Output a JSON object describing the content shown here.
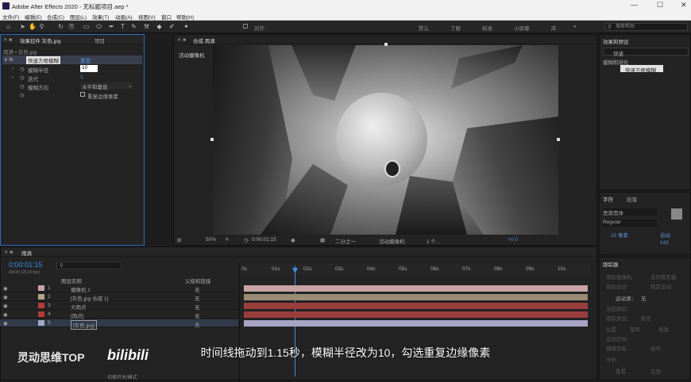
{
  "window": {
    "title": "Adobe After Effects 2020 - 无标题项目.aep *",
    "min": "—",
    "max": "☐",
    "close": "✕"
  },
  "menu": [
    "文件(F)",
    "编辑(E)",
    "合成(C)",
    "图层(L)",
    "效果(T)",
    "动画(A)",
    "视图(V)",
    "窗口",
    "帮助(H)"
  ],
  "toolbar": {
    "snap_label": "对齐",
    "workspaces": [
      "默认",
      "了解",
      "标准",
      "小屏幕",
      "库"
    ],
    "search_placeholder": "搜索帮助"
  },
  "effects_panel": {
    "tab_label": "效果控件 灰色.jpg",
    "project_tab": "项目",
    "breadcrumb": "雨滴 • 灰色.jpg",
    "effect_name": "快速方框模糊",
    "reset": "重置",
    "props": [
      {
        "label": "模糊半径",
        "value": "10"
      },
      {
        "label": "迭代",
        "value": "1"
      },
      {
        "label": "模糊方向",
        "value": "水平和垂直"
      }
    ],
    "checkbox_label": "重复边缘像素"
  },
  "comp_panel": {
    "tab_label": "合成 雨滴",
    "camera_label": "活动摄像机",
    "zoom": "50%",
    "timecode": "0:00:01:15",
    "resolution": "二分之一",
    "view": "活动摄像机",
    "views": "1 个...",
    "offset": "+0.0"
  },
  "right_panel": {
    "tab_label": "效果和预设",
    "search_value": "快速",
    "category": "模糊和锐化",
    "result": "快速方框模糊"
  },
  "char_panel": {
    "tab_label": "字符",
    "tab2": "段落",
    "font": "思源黑体",
    "style": "Regular",
    "size": "25 像素",
    "auto": "自动",
    "tracking": "142"
  },
  "tracker_panel": {
    "tab_label": "跟踪器",
    "track_camera": "跟踪摄像机",
    "warp": "变形稳定器",
    "track_motion": "跟踪运动",
    "stabilize": "稳定运动",
    "source_label": "运动源：",
    "source_value": "无",
    "current": "当前跟踪：",
    "type": "跟踪类型：",
    "type_value": "稳定",
    "pos": "位置",
    "rot": "旋转",
    "scale": "缩放",
    "target": "运动目标：",
    "edit_target": "编辑目标...",
    "options": "选项...",
    "analyze": "分析：",
    "reset": "重置",
    "apply": "应用"
  },
  "timeline": {
    "tab_label": "雨滴",
    "timecode": "0:00:01:15",
    "frames": "00040 (25.00 fps)",
    "col_layer": "图层名称",
    "col_parent": "父级和链接",
    "toggle": "切换开关/模式",
    "ruler": [
      "0s",
      "01s",
      "02s",
      "03s",
      "04s",
      "05s",
      "06s",
      "07s",
      "08s",
      "09s",
      "10s"
    ],
    "layers": [
      {
        "num": "1",
        "name": "摄像机 1",
        "parent": "无",
        "color": "#c7a5a5",
        "bar": "#c7a5a5",
        "sel": false
      },
      {
        "num": "2",
        "name": "[灰色.jpg 合成 1]",
        "parent": "无",
        "color": "#b1a489",
        "bar": "#9a8c76",
        "sel": false
      },
      {
        "num": "3",
        "name": "大雨点",
        "parent": "无",
        "color": "#b83b3b",
        "bar": "#9b3d3d",
        "sel": false
      },
      {
        "num": "4",
        "name": "[雨点]",
        "parent": "无",
        "color": "#b83b3b",
        "bar": "#9b3d3d",
        "sel": false
      },
      {
        "num": "5",
        "name": "[灰色.jpg]",
        "parent": "无",
        "color": "#a7a7c8",
        "bar": "#a8a4c4",
        "sel": true
      }
    ]
  },
  "subtitle": "时间线拖动到1.15秒，模糊半径改为10，勾选重复边缘像素",
  "watermark": "灵动思维TOP",
  "watermark_logo": "bilibili"
}
